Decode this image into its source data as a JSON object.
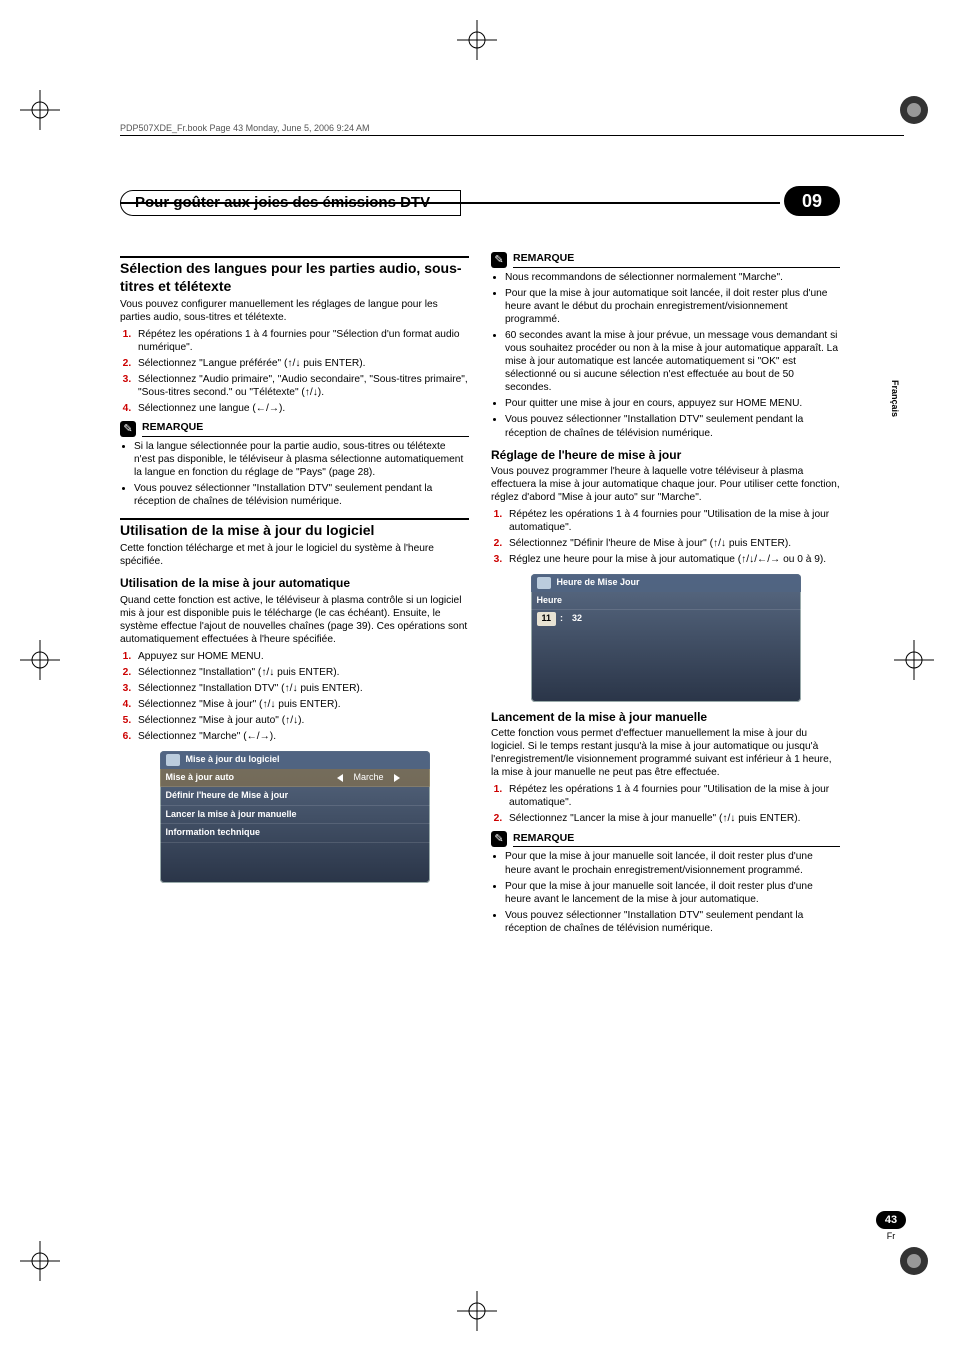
{
  "header_running": "PDP507XDE_Fr.book  Page 43  Monday, June 5, 2006  9:24 AM",
  "chapter": {
    "title": "Pour goûter aux joies des émissions DTV",
    "num": "09"
  },
  "side_lang": "Français",
  "page_num": "43",
  "page_lang": "Fr",
  "left": {
    "sec1_title": "Sélection des langues pour les parties audio, sous-titres et télétexte",
    "sec1_intro": "Vous pouvez configurer manuellement les réglages de langue pour les parties audio, sous-titres et télétexte.",
    "sec1_steps": [
      "Répétez les opérations 1 à 4 fournies pour \"Sélection d'un format audio numérique\".",
      "Sélectionnez \"Langue préférée\" (↑/↓ puis ENTER).",
      "Sélectionnez \"Audio primaire\", \"Audio secondaire\", \"Sous-titres primaire\", \"Sous-titres second.\" ou \"Télétexte\" (↑/↓).",
      "Sélectionnez une langue (←/→)."
    ],
    "note1_title": "REMARQUE",
    "note1_items": [
      "Si la langue sélectionnée pour la partie audio, sous-titres ou télétexte n'est pas disponible, le téléviseur à plasma sélectionne automatiquement la langue en fonction du réglage de \"Pays\" (page 28).",
      "Vous pouvez sélectionner \"Installation DTV\" seulement pendant la réception de chaînes de télévision numérique."
    ],
    "sec2_title": "Utilisation de la mise à jour du logiciel",
    "sec2_intro": "Cette fonction télécharge et met à jour le logiciel du système à l'heure spécifiée.",
    "sub1_title": "Utilisation de la mise à jour automatique",
    "sub1_intro": "Quand cette fonction est active, le téléviseur à plasma contrôle si un logiciel mis à jour est disponible puis le télécharge (le cas échéant). Ensuite, le système effectue l'ajout de nouvelles chaînes (page 39). Ces opérations sont automatiquement effectuées à l'heure spécifiée.",
    "sub1_steps": [
      "Appuyez sur HOME MENU.",
      "Sélectionnez \"Installation\" (↑/↓ puis ENTER).",
      "Sélectionnez \"Installation DTV\" (↑/↓ puis ENTER).",
      "Sélectionnez \"Mise à jour\" (↑/↓ puis ENTER).",
      "Sélectionnez \"Mise à jour auto\" (↑/↓).",
      "Sélectionnez \"Marche\" (←/→)."
    ],
    "panel1": {
      "title": "Mise à jour du logiciel",
      "rows": [
        {
          "label": "Mise à jour auto",
          "value": "Marche",
          "highlight": true
        },
        {
          "label": "Définir l'heure de Mise à jour"
        },
        {
          "label": "Lancer la mise à jour manuelle"
        },
        {
          "label": "Information technique"
        }
      ]
    }
  },
  "right": {
    "note2_title": "REMARQUE",
    "note2_items": [
      "Nous recommandons de sélectionner normalement \"Marche\".",
      "Pour que la mise à jour automatique soit lancée, il doit rester plus d'une heure avant le début du prochain enregistrement/visionnement programmé.",
      "60 secondes avant la mise à jour prévue, un message vous demandant si vous souhaitez procéder ou non à la mise à jour automatique apparaît. La mise à jour automatique est lancée automatiquement si \"OK\" est sélectionné ou si aucune sélection n'est effectuée au bout de 50 secondes.",
      "Pour quitter une mise à jour en cours, appuyez sur HOME MENU.",
      "Vous pouvez sélectionner \"Installation DTV\" seulement pendant la réception de chaînes de télévision numérique."
    ],
    "sub2_title": "Réglage de l'heure de mise à jour",
    "sub2_intro": "Vous pouvez programmer l'heure à laquelle votre téléviseur à plasma effectuera la mise à jour automatique chaque jour. Pour utiliser cette fonction, réglez d'abord \"Mise à jour auto\" sur \"Marche\".",
    "sub2_steps": [
      "Répétez les opérations 1 à 4 fournies pour \"Utilisation de la mise à jour automatique\".",
      "Sélectionnez \"Définir l'heure de Mise à jour\" (↑/↓ puis ENTER).",
      "Réglez une heure pour la mise à jour automatique (↑/↓/←/→ ou 0 à 9)."
    ],
    "panel2": {
      "title": "Heure de Mise Jour",
      "label": "Heure",
      "hh": "11",
      "mm": "32"
    },
    "sub3_title": "Lancement de la mise à jour manuelle",
    "sub3_intro": "Cette fonction vous permet d'effectuer manuellement la mise à jour du logiciel. Si le temps restant jusqu'à la mise à jour automatique ou jusqu'à l'enregistrement/le visionnement programmé suivant est inférieur à 1 heure, la mise à jour manuelle ne peut pas être effectuée.",
    "sub3_steps": [
      "Répétez les opérations 1 à 4 fournies pour \"Utilisation de la mise à jour automatique\".",
      "Sélectionnez \"Lancer la mise à jour manuelle\" (↑/↓ puis ENTER)."
    ],
    "note3_title": "REMARQUE",
    "note3_items": [
      "Pour que la mise à jour manuelle soit lancée, il doit rester plus d'une heure avant le prochain enregistrement/visionnement programmé.",
      "Pour que la mise à jour manuelle soit lancée, il doit rester plus d'une heure avant le lancement de la mise à jour automatique.",
      "Vous pouvez sélectionner \"Installation DTV\" seulement pendant la réception de chaînes de télévision numérique."
    ]
  }
}
